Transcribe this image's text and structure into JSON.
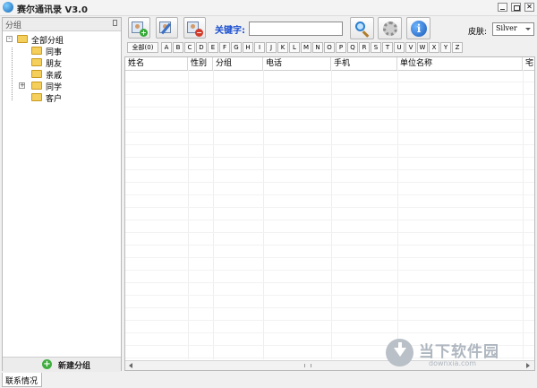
{
  "window": {
    "title": "赛尔通讯录 V3.0"
  },
  "left_panel": {
    "header": "分组",
    "tree": [
      {
        "label": "全部分组",
        "level": 0,
        "expander": "−"
      },
      {
        "label": "同事",
        "level": 1,
        "expander": ""
      },
      {
        "label": "朋友",
        "level": 1,
        "expander": ""
      },
      {
        "label": "亲戚",
        "level": 1,
        "expander": ""
      },
      {
        "label": "同学",
        "level": 1,
        "expander": "+"
      },
      {
        "label": "客户",
        "level": 1,
        "expander": ""
      }
    ],
    "new_group_button": "新建分组"
  },
  "toolbar": {
    "keyword_label": "关键字:",
    "keyword_value": "",
    "skin_label": "皮肤:",
    "skin_value": "Silver"
  },
  "alphabet": [
    "全部(0)",
    "A",
    "B",
    "C",
    "D",
    "E",
    "F",
    "G",
    "H",
    "I",
    "J",
    "K",
    "L",
    "M",
    "N",
    "O",
    "P",
    "Q",
    "R",
    "S",
    "T",
    "U",
    "V",
    "W",
    "X",
    "Y",
    "Z"
  ],
  "grid": {
    "columns": [
      "姓名",
      "性别",
      "分组",
      "电话",
      "手机",
      "单位名称",
      "宅"
    ]
  },
  "watermark": {
    "text": "当下软件园",
    "url": "downxia.com"
  },
  "bottom_tabs": [
    "联系情况"
  ]
}
